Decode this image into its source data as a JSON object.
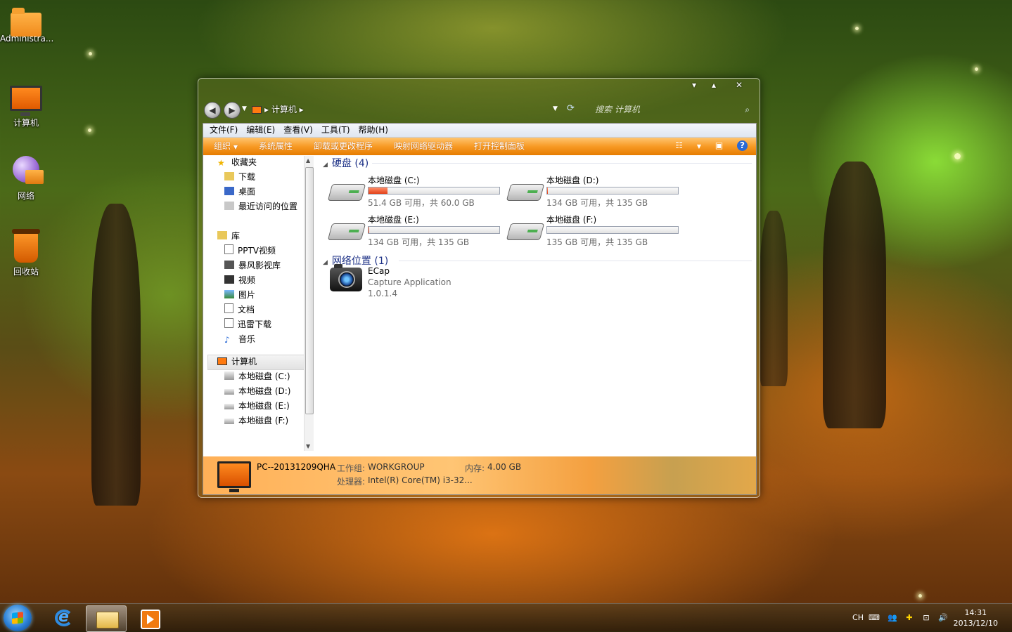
{
  "desktop": {
    "icons": [
      {
        "label": "Administra..."
      },
      {
        "label": "计算机"
      },
      {
        "label": "网络"
      },
      {
        "label": "回收站"
      }
    ]
  },
  "window": {
    "address": "计算机",
    "search_placeholder": "搜索 计算机",
    "menu": [
      "文件(F)",
      "编辑(E)",
      "查看(V)",
      "工具(T)",
      "帮助(H)"
    ],
    "commands": [
      "组织",
      "系统属性",
      "卸载或更改程序",
      "映射网络驱动器",
      "打开控制面板"
    ],
    "nav_tree": {
      "favorites": {
        "label": "收藏夹",
        "items": [
          "下载",
          "桌面",
          "最近访问的位置"
        ]
      },
      "libraries": {
        "label": "库",
        "items": [
          "PPTV视频",
          "暴风影视库",
          "视频",
          "图片",
          "文档",
          "迅雷下载",
          "音乐"
        ]
      },
      "computer": {
        "label": "计算机",
        "items": [
          "本地磁盘 (C:)",
          "本地磁盘 (D:)",
          "本地磁盘 (E:)",
          "本地磁盘 (F:)"
        ]
      }
    },
    "groups": {
      "hdd": {
        "title": "硬盘 (4)"
      },
      "network": {
        "title": "网络位置 (1)"
      }
    },
    "drives": [
      {
        "name": "本地磁盘 (C:)",
        "free_text": "51.4 GB 可用，共 60.0 GB",
        "used_fraction": 0.143
      },
      {
        "name": "本地磁盘 (D:)",
        "free_text": "134 GB 可用，共 135 GB",
        "used_fraction": 0.007
      },
      {
        "name": "本地磁盘 (E:)",
        "free_text": "134 GB 可用，共 135 GB",
        "used_fraction": 0.007
      },
      {
        "name": "本地磁盘 (F:)",
        "free_text": "135 GB 可用，共 135 GB",
        "used_fraction": 0.0
      }
    ],
    "network_item": {
      "name": "ECap",
      "desc": "Capture Application",
      "version": "1.0.1.4"
    },
    "details": {
      "pc_name": "PC--20131209QHA",
      "workgroup_label": "工作组:",
      "workgroup": "WORKGROUP",
      "memory_label": "内存:",
      "memory": "4.00 GB",
      "cpu_label": "处理器:",
      "cpu": "Intel(R) Core(TM) i3-32..."
    }
  },
  "taskbar": {
    "lang": "CH",
    "time": "14:31",
    "date": "2013/12/10"
  }
}
